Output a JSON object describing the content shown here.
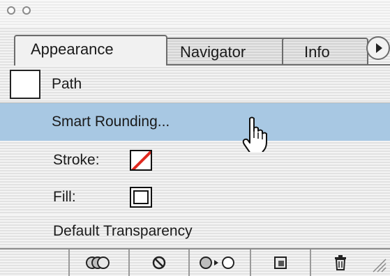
{
  "tabs": [
    {
      "label": "Appearance",
      "active": true
    },
    {
      "label": "Navigator",
      "active": false
    },
    {
      "label": "Info",
      "active": false
    }
  ],
  "object": {
    "label": "Path"
  },
  "rows": {
    "smart": "Smart Rounding...",
    "stroke": "Stroke:",
    "fill": "Fill:",
    "default": "Default Transparency"
  },
  "colors": {
    "highlight": "#a8c8e3",
    "stroke_none_slash": "#e0291f"
  },
  "toolbar": [
    {
      "name": "new-art-basic-appearance-icon"
    },
    {
      "name": "clear-appearance-icon"
    },
    {
      "name": "reduce-to-basic-appearance-icon"
    },
    {
      "name": "duplicate-item-icon"
    },
    {
      "name": "delete-item-icon"
    }
  ]
}
